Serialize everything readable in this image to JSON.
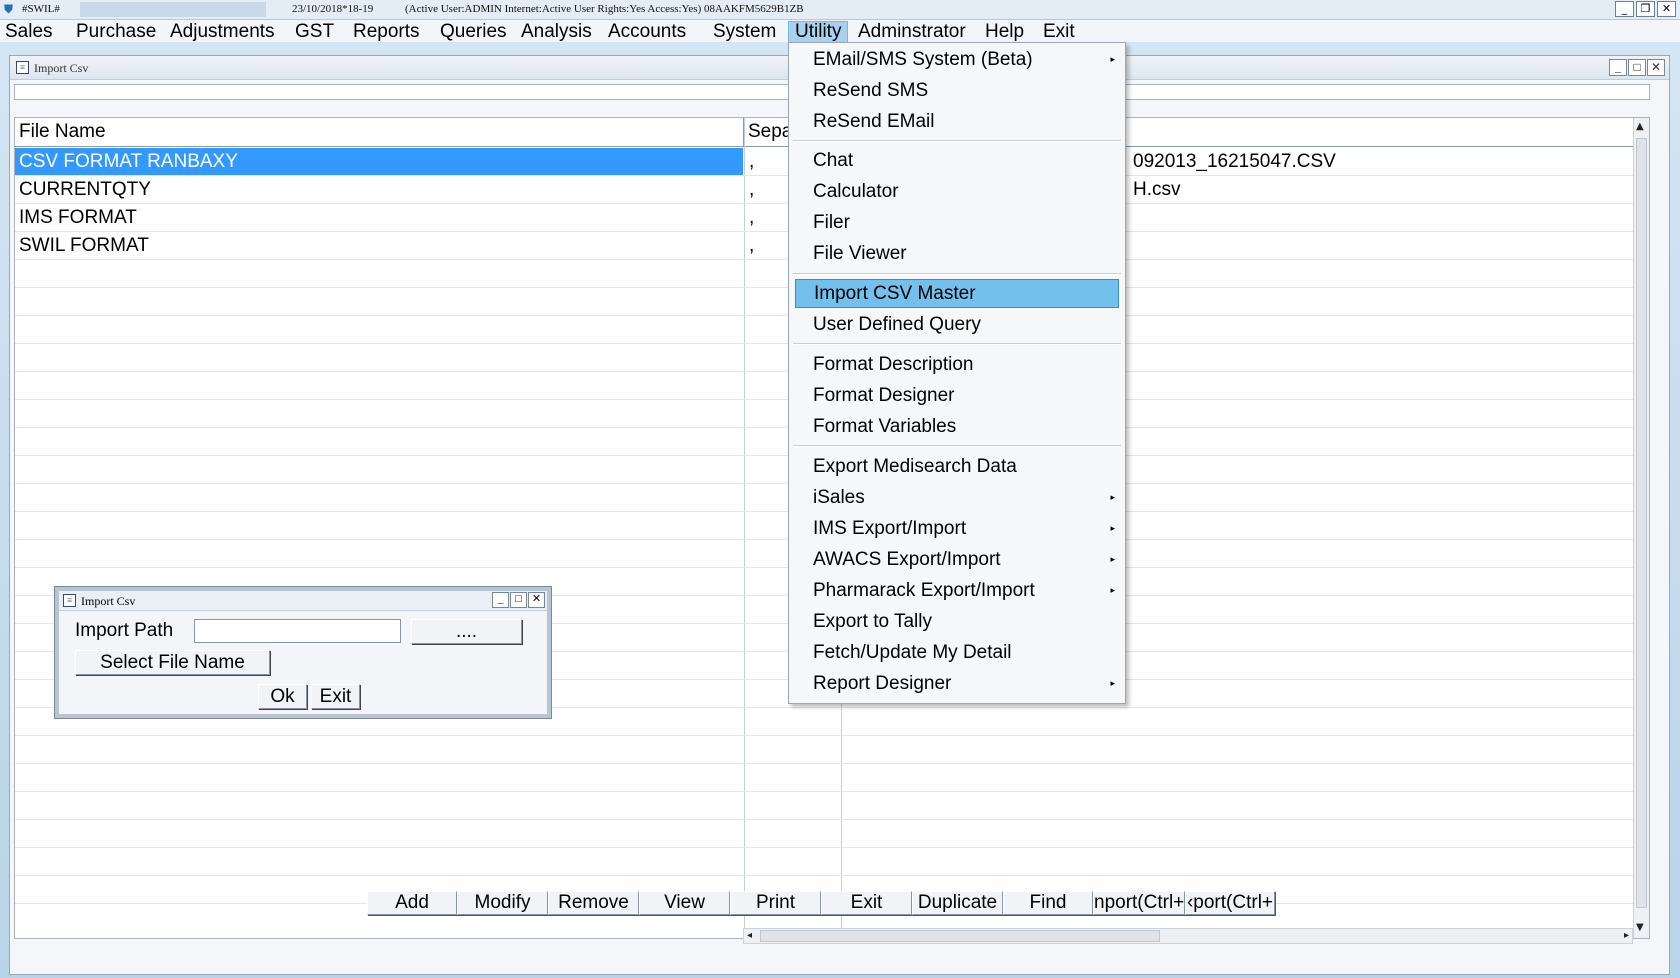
{
  "titlebar": {
    "app": "#SWIL#",
    "date": "23/10/2018*18-19",
    "status": "(Active User:ADMIN Internet:Active  User Rights:Yes Access:Yes) 08AAKFM5629B1ZB",
    "min": "_",
    "restore": "❐",
    "close": "✕"
  },
  "menu": {
    "items": [
      "Sales",
      "Purchase",
      "Adjustments",
      "GST",
      "Reports",
      "Queries",
      "Analysis",
      "Accounts",
      "System",
      "Utility",
      "Adminstrator",
      "Help",
      "Exit"
    ],
    "active": "Utility"
  },
  "main_window": {
    "title": "Import Csv",
    "min": "_",
    "restore": "□",
    "close": "✕"
  },
  "grid": {
    "headers": [
      "File Name",
      "Sepa"
    ],
    "rows": [
      {
        "name": "CSV FORMAT RANBAXY",
        "sep": ",",
        "file": "092013_16215047.CSV",
        "selected": true
      },
      {
        "name": "CURRENTQTY",
        "sep": ",",
        "file": "H.csv",
        "selected": false
      },
      {
        "name": "IMS FORMAT",
        "sep": ",",
        "file": "",
        "selected": false
      },
      {
        "name": "SWIL FORMAT",
        "sep": ",",
        "file": "",
        "selected": false
      }
    ]
  },
  "toolbar": {
    "buttons": [
      "Add",
      "Modify",
      "Remove",
      "View",
      "Print",
      "Exit",
      "Duplicate",
      "Find",
      "nport(Ctrl+",
      "‹port(Ctrl+"
    ]
  },
  "dialog": {
    "title": "Import Csv",
    "import_path_label": "Import Path",
    "import_path_value": "",
    "browse_label": "....",
    "select_file_label": "Select File Name",
    "ok_label": "Ok",
    "exit_label": "Exit",
    "min": "_",
    "restore": "□",
    "close": "✕"
  },
  "utility_menu": {
    "items": [
      {
        "label": "EMail/SMS System (Beta)",
        "submenu": true
      },
      {
        "label": "ReSend SMS"
      },
      {
        "label": "ReSend EMail"
      },
      {
        "separator": true
      },
      {
        "label": "Chat"
      },
      {
        "label": "Calculator"
      },
      {
        "label": "Filer"
      },
      {
        "label": "File Viewer"
      },
      {
        "separator": true
      },
      {
        "label": "Import CSV Master",
        "highlighted": true
      },
      {
        "label": "User Defined Query"
      },
      {
        "separator": true
      },
      {
        "label": "Format Description"
      },
      {
        "label": "Format Designer"
      },
      {
        "label": "Format Variables"
      },
      {
        "separator": true
      },
      {
        "label": "Export Medisearch Data"
      },
      {
        "label": "iSales",
        "submenu": true
      },
      {
        "label": "IMS Export/Import",
        "submenu": true
      },
      {
        "label": "AWACS Export/Import",
        "submenu": true
      },
      {
        "label": "Pharmarack Export/Import",
        "submenu": true
      },
      {
        "label": "Export to Tally"
      },
      {
        "label": "Fetch/Update My Detail"
      },
      {
        "label": "Report Designer",
        "submenu": true
      }
    ]
  },
  "icons": {
    "submenu_arrow": "▸",
    "scroll_up": "▲",
    "scroll_down": "▼",
    "scroll_left": "◂",
    "scroll_right": "▸"
  }
}
